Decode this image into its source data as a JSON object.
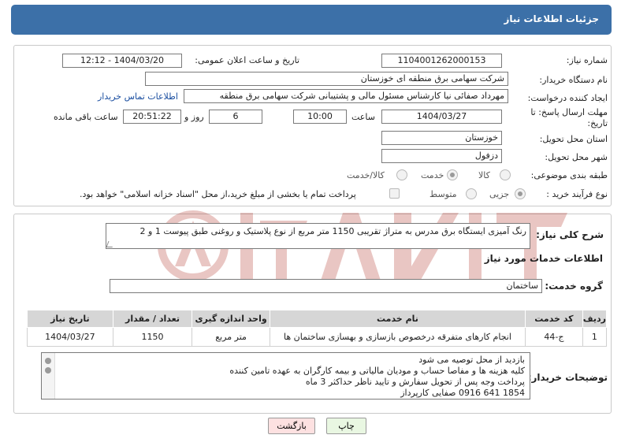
{
  "header": {
    "title": "جزئیات اطلاعات نیاز"
  },
  "form": {
    "need_number_label": "شماره نیاز:",
    "need_number_value": "1104001262000153",
    "announce_label": "تاریخ و ساعت اعلان عمومی:",
    "announce_value": "1404/03/20 - 12:12",
    "buyer_org_label": "نام دستگاه خریدار:",
    "buyer_org_value": "شرکت سهامی برق منطقه ای خوزستان",
    "creator_label": "ایجاد کننده درخواست:",
    "creator_value": "مهرداد صفائی نیا کارشناس مسئول مالی و پشتیبانی شرکت سهامی برق منطقه",
    "contact_link": "اطلاعات تماس خریدار",
    "deadline_label": "مهلت ارسال پاسخ: تا تاریخ:",
    "deadline_date": "1404/03/27",
    "time_label": "ساعت",
    "deadline_time": "10:00",
    "days_value": "6",
    "days_label": "روز و",
    "remaining_time": "20:51:22",
    "remaining_label": "ساعت باقی مانده",
    "province_label": "استان محل تحویل:",
    "province_value": "خوزستان",
    "city_label": "شهر محل تحویل:",
    "city_value": "دزفول",
    "category_label": "طبقه بندی موضوعی:",
    "category_options": {
      "goods": "کالا",
      "service": "خدمت",
      "goods_service": "کالا/خدمت"
    },
    "category_selected": "service",
    "process_label": "نوع فرآیند خرید :",
    "process_options": {
      "partial": "جزیی",
      "medium": "متوسط"
    },
    "process_selected": "partial",
    "treasury_text": "پرداخت تمام یا بخشی از مبلغ خرید،از محل \"اسناد خزانه اسلامی\" خواهد بود."
  },
  "description": {
    "label": "شرح کلی نیاز:",
    "value": "رنگ آمیزی ایستگاه برق مدرس به متراژ تقریبی 1150 متر مربع از نوع پلاستیک و روغنی طبق پیوست 1 و 2"
  },
  "services": {
    "heading": "اطلاعات خدمات مورد نیاز",
    "group_label": "گروه خدمت:",
    "group_value": "ساختمان",
    "columns": {
      "row": "ردیف",
      "code": "کد خدمت",
      "name": "نام خدمت",
      "unit": "واحد اندازه گیری",
      "qty": "تعداد / مقدار",
      "date": "تاریخ نیاز"
    },
    "rows": [
      {
        "row": "1",
        "code": "ج-44",
        "name": "انجام کارهای متفرقه درخصوص بازسازی و بهسازی ساختمان ها",
        "unit": "متر مربع",
        "qty": "1150",
        "date": "1404/03/27"
      }
    ]
  },
  "buyer_notes": {
    "label": "توضیحات خریدار:",
    "lines": [
      "بازدید از محل توصیه می شود",
      "کلیه هزینه ها و مفاصا حساب و مودیان مالیاتی و بیمه کارگران به عهده تامین کننده",
      "پرداخت وجه پس از تحویل سفارش و تایید ناظر حداکثر 3 ماه",
      "1854 641 0916 صفایی کارپرداز"
    ]
  },
  "buttons": {
    "print": "چاپ",
    "back": "بازگشت"
  },
  "colors": {
    "header_bg": "#3c70a8",
    "link": "#1a4ea0",
    "back_button_bg": "#fde1e1",
    "print_button_bg": "#e9f7e2"
  }
}
